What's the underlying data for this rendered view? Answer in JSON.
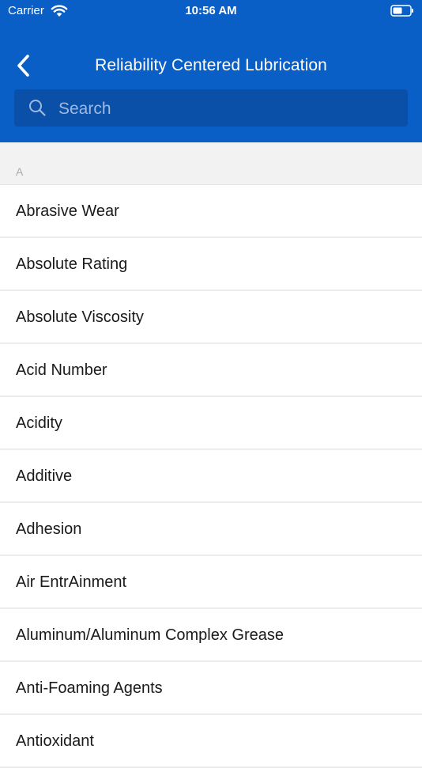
{
  "status_bar": {
    "carrier": "Carrier",
    "time": "10:56 AM"
  },
  "nav": {
    "title": "Reliability Centered Lubrication",
    "back_icon": "chevron-left-icon"
  },
  "search": {
    "placeholder": "Search",
    "value": ""
  },
  "section": {
    "letter": "A"
  },
  "items": [
    {
      "label": "Abrasive Wear"
    },
    {
      "label": "Absolute Rating"
    },
    {
      "label": "Absolute Viscosity"
    },
    {
      "label": "Acid Number"
    },
    {
      "label": "Acidity"
    },
    {
      "label": "Additive"
    },
    {
      "label": "Adhesion"
    },
    {
      "label": "Air EntrAinment"
    },
    {
      "label": "Aluminum/Aluminum Complex Grease"
    },
    {
      "label": "Anti-Foaming Agents"
    },
    {
      "label": "Antioxidant"
    }
  ],
  "colors": {
    "header_blue": "#0a5fc6",
    "search_blue": "#0a4fa8",
    "section_bg": "#f2f2f2"
  }
}
